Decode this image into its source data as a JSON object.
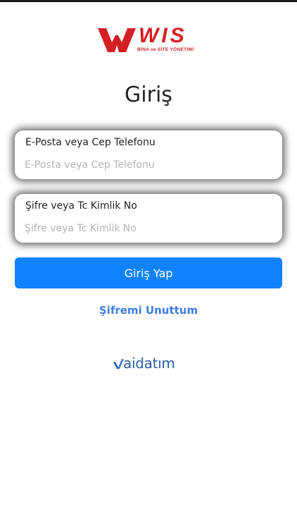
{
  "logo": {
    "wordmark": "WIS",
    "tagline": "BİNA ve SİTE YÖNETİMİ"
  },
  "title": "Giriş",
  "email": {
    "label": "E-Posta veya Cep Telefonu",
    "placeholder": "E-Posta veya Cep Telefonu",
    "value": ""
  },
  "password": {
    "label": "Şifre veya Tc Kimlik No",
    "placeholder": "Şifre veya Tc Kimlik No",
    "value": ""
  },
  "login_button": "Giriş Yap",
  "forgot_link": "Şifremi Unuttum",
  "brand": {
    "name": "aidatım"
  },
  "colors": {
    "accent": "#0f82ff",
    "link": "#3f7ce0",
    "logo_red": "#d51f26",
    "brand_blue": "#2d5ea8"
  }
}
